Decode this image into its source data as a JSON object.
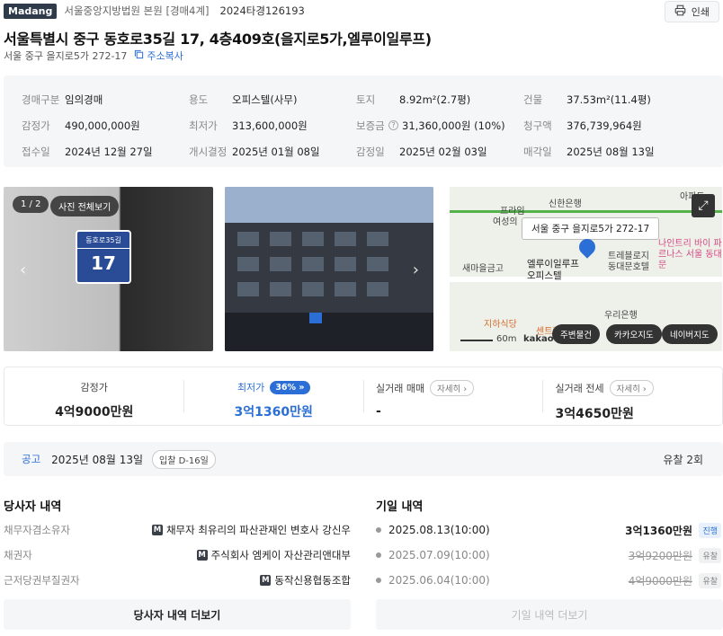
{
  "header": {
    "brand": "Madang",
    "court": "서울중앙지방법원 본원 [경매4계]",
    "case_no": "2024타경126193",
    "print_label": "인쇄"
  },
  "property": {
    "title": "서울특별시 중구 동호로35길 17, 4층409호(을지로5가,엘루이일루프)",
    "lot_address": "서울 중구 을지로5가 272-17",
    "copy_label": "주소복사"
  },
  "info": {
    "rows": [
      [
        {
          "k": "경매구분",
          "v": "임의경매"
        },
        {
          "k": "용도",
          "v": "오피스텔(사무)"
        },
        {
          "k": "토지",
          "v": "8.92m²(2.7평)"
        },
        {
          "k": "건물",
          "v": "37.53m²(11.4평)"
        }
      ],
      [
        {
          "k": "감정가",
          "v": "490,000,000원"
        },
        {
          "k": "최저가",
          "v": "313,600,000원"
        },
        {
          "k": "보증금",
          "v": "31,360,000원 (10%)"
        },
        {
          "k": "청구액",
          "v": "376,739,964원"
        }
      ],
      [
        {
          "k": "접수일",
          "v": "2024년 12월 27일"
        },
        {
          "k": "개시결정",
          "v": "2025년 01월 08일"
        },
        {
          "k": "감정일",
          "v": "2025년 02월 03일"
        },
        {
          "k": "매각일",
          "v": "2025년 08월 13일"
        }
      ]
    ]
  },
  "photos": {
    "counter": "1 / 2",
    "all_photos_label": "사진 전체보기",
    "plate_street": "동호로35길",
    "plate_number": "17"
  },
  "map": {
    "address_label": "서울 중구 을지로5가 272-17",
    "building_name": "엘루이일루프 오피스텔",
    "places": [
      "신한은행",
      "프라임",
      "여성의",
      "트레블로지 동대문호텔",
      "나인트리 바이 파르나스 서울 동대문",
      "새마을금고",
      "지하식당",
      "우리은행",
      "센트럴",
      "아파트"
    ],
    "scale": "60m",
    "provider": "kakao",
    "buttons": [
      "주변물건",
      "카카오지도",
      "네이버지도"
    ]
  },
  "prices": {
    "appraisal_label": "감정가",
    "appraisal_value": "4억9000만원",
    "min_label": "최저가",
    "min_pct": "36%",
    "min_value": "3억1360만원",
    "trade_label": "실거래 매매",
    "trade_value": "-",
    "jeonse_label": "실거래 전세",
    "jeonse_value": "3억4650만원",
    "detail_label": "자세히"
  },
  "notice": {
    "label": "공고",
    "date": "2025년 08월 13일",
    "dday": "입찰 D-16일",
    "fail_count": "유찰 2회"
  },
  "parties": {
    "title": "당사자 내역",
    "rows": [
      {
        "role": "채무자겸소유자",
        "name": "채무자 최유리의 파산관재인 변호사 강신우"
      },
      {
        "role": "채권자",
        "name": "주식회사 엠케이 자산관리앤대부"
      },
      {
        "role": "근저당권부질권자",
        "name": "동작신용협동조합"
      }
    ],
    "more_label": "당사자 내역 더보기"
  },
  "history": {
    "title": "기일 내역",
    "rows": [
      {
        "date": "2025.08.13(10:00)",
        "amount": "3억1360만원",
        "status": "진행"
      },
      {
        "date": "2025.07.09(10:00)",
        "amount": "3억9200만원",
        "status": "유찰"
      },
      {
        "date": "2025.06.04(10:00)",
        "amount": "4억9000만원",
        "status": "유찰"
      }
    ],
    "more_label": "기일 내역 더보기"
  },
  "colors": {
    "accent": "#2b6fd6",
    "brand_badge": "#2f3a4a",
    "panel_bg": "#f5f6f8"
  }
}
